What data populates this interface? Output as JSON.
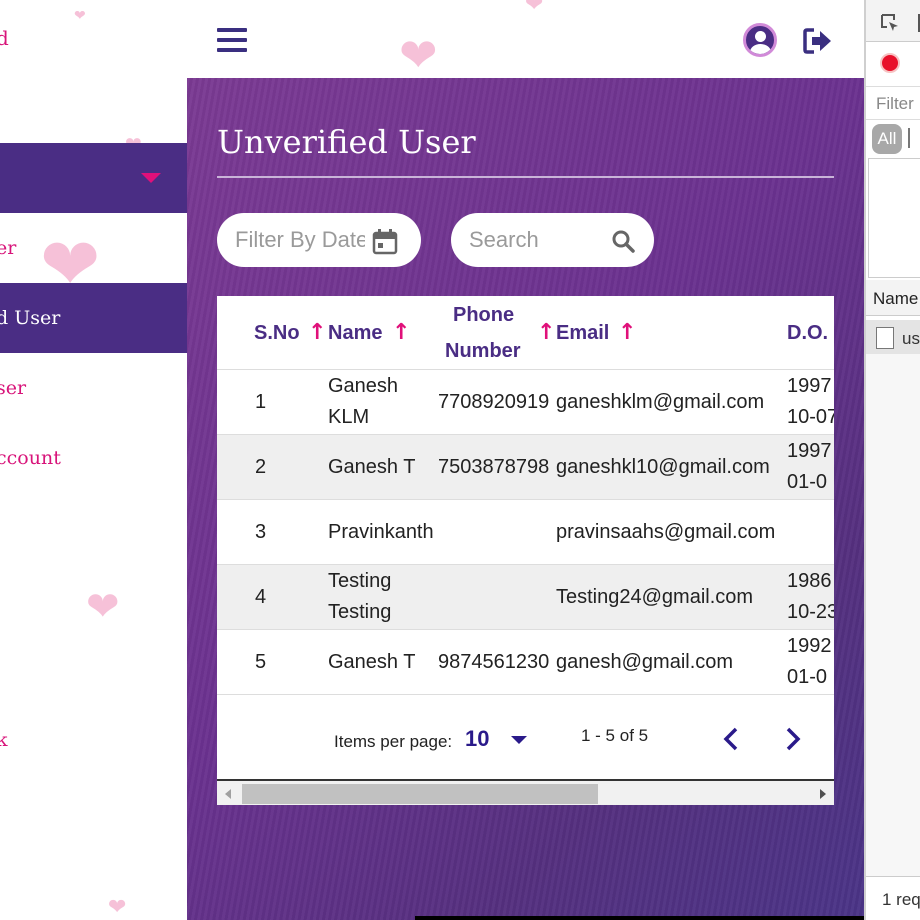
{
  "sidebar": {
    "top_fragment": "d",
    "items": [
      {
        "label": "er",
        "active": false
      },
      {
        "label": "d User",
        "active": true
      },
      {
        "label": "ser",
        "active": false
      },
      {
        "label": "ccount",
        "active": false
      },
      {
        "label": "k",
        "active": false
      }
    ]
  },
  "header": {
    "menu_icon": "hamburger-menu-icon",
    "profile_icon": "user-circle-icon",
    "logout_icon": "logout-icon"
  },
  "main": {
    "title": "Unverified User",
    "filter_date_placeholder": "Filter By Date",
    "search_placeholder": "Search"
  },
  "table": {
    "columns": [
      {
        "label": "S.No",
        "sortable": true
      },
      {
        "label": "Name",
        "sortable": true
      },
      {
        "label": "Phone Number",
        "line1": "Phone",
        "line2": "Number",
        "sortable": true
      },
      {
        "label": "Email",
        "sortable": true
      },
      {
        "label": "D.O.",
        "sortable": false
      }
    ],
    "rows": [
      {
        "sno": "1",
        "name": "Ganesh KLM",
        "name_l1": "Ganesh",
        "name_l2": "KLM",
        "phone": "7708920919",
        "email": "ganeshklm@gmail.com",
        "dob_l1": "1997",
        "dob_l2": "10-07"
      },
      {
        "sno": "2",
        "name": "Ganesh T",
        "name_l1": "Ganesh T",
        "name_l2": "",
        "phone": "7503878798",
        "email": "ganeshkl10@gmail.com",
        "dob_l1": "1997",
        "dob_l2": "01-0"
      },
      {
        "sno": "3",
        "name": "Pravinkanth",
        "name_l1": "Pravinkanth",
        "name_l2": "",
        "phone": "",
        "email": "pravinsaahs@gmail.com",
        "dob_l1": "",
        "dob_l2": ""
      },
      {
        "sno": "4",
        "name": "Testing Testing",
        "name_l1": "Testing",
        "name_l2": "Testing",
        "phone": "",
        "email": "Testing24@gmail.com",
        "dob_l1": "1986",
        "dob_l2": "10-23"
      },
      {
        "sno": "5",
        "name": "Ganesh T",
        "name_l1": "Ganesh T",
        "name_l2": "",
        "phone": "9874561230",
        "email": "ganesh@gmail.com",
        "dob_l1": "1992",
        "dob_l2": "01-0"
      }
    ]
  },
  "paginator": {
    "items_per_page_label": "Items per page:",
    "items_per_page_value": "10",
    "range_label": "1 - 5 of 5"
  },
  "devtools": {
    "filter_placeholder": "Filter",
    "all_label": "All",
    "name_header": "Name",
    "row_label": "us",
    "footer": "1 req"
  },
  "colors": {
    "primary": "#4a2d84",
    "accent_pink": "#e0107a",
    "paginator_blue": "#2a1a8a"
  }
}
